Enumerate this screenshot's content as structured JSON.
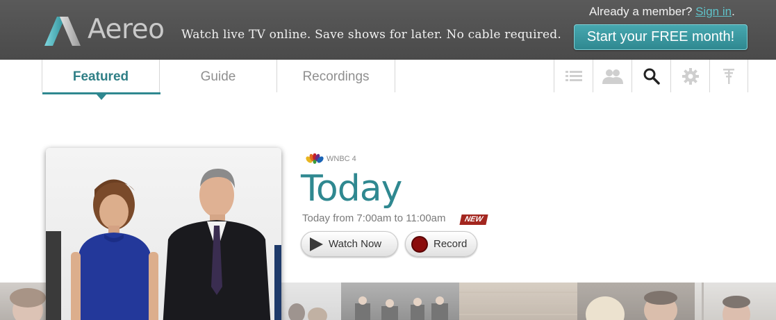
{
  "header": {
    "logo_text": "Aereo",
    "tagline": "Watch live TV online. Save shows for later. No cable required.",
    "member_prompt": "Already a member?",
    "sign_in_label": "Sign in",
    "member_suffix": ".",
    "cta_label": "Start your FREE month!"
  },
  "nav": {
    "tabs": [
      {
        "label": "Featured",
        "active": true
      },
      {
        "label": "Guide",
        "active": false
      },
      {
        "label": "Recordings",
        "active": false
      }
    ],
    "icons": [
      "list-icon",
      "people-icon",
      "search-icon",
      "gear-icon",
      "antenna-icon"
    ]
  },
  "featured_show": {
    "channel": "WNBC 4",
    "title": "Today",
    "airtime": "Today from 7:00am to 11:00am",
    "badge": "NEW",
    "watch_label": "Watch Now",
    "record_label": "Record"
  },
  "thumbnails": [
    "thumb-1",
    "thumb-2",
    "thumb-3",
    "thumb-4",
    "thumb-5",
    "thumb-6",
    "thumb-7"
  ],
  "colors": {
    "accent": "#2f8890",
    "topbar": "#4f4f4f",
    "new_badge": "#a3261f",
    "record_red": "#8b0d0d"
  }
}
